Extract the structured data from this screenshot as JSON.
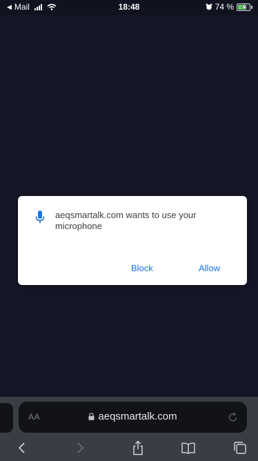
{
  "status_bar": {
    "back_app": "Mail",
    "time": "18:48",
    "battery": "74 %",
    "battery_level": 0.74
  },
  "dialog": {
    "message": "aeqsmartalk.com wants to use your microphone",
    "block_label": "Block",
    "allow_label": "Allow",
    "accent_color": "#1a73e8"
  },
  "browser": {
    "text_size_label": "AA",
    "url": "aeqsmartalk.com",
    "page_background": "#151726"
  },
  "toolbar": {
    "icons": [
      "back-icon",
      "forward-icon",
      "share-icon",
      "bookmarks-icon",
      "tabs-icon"
    ]
  }
}
